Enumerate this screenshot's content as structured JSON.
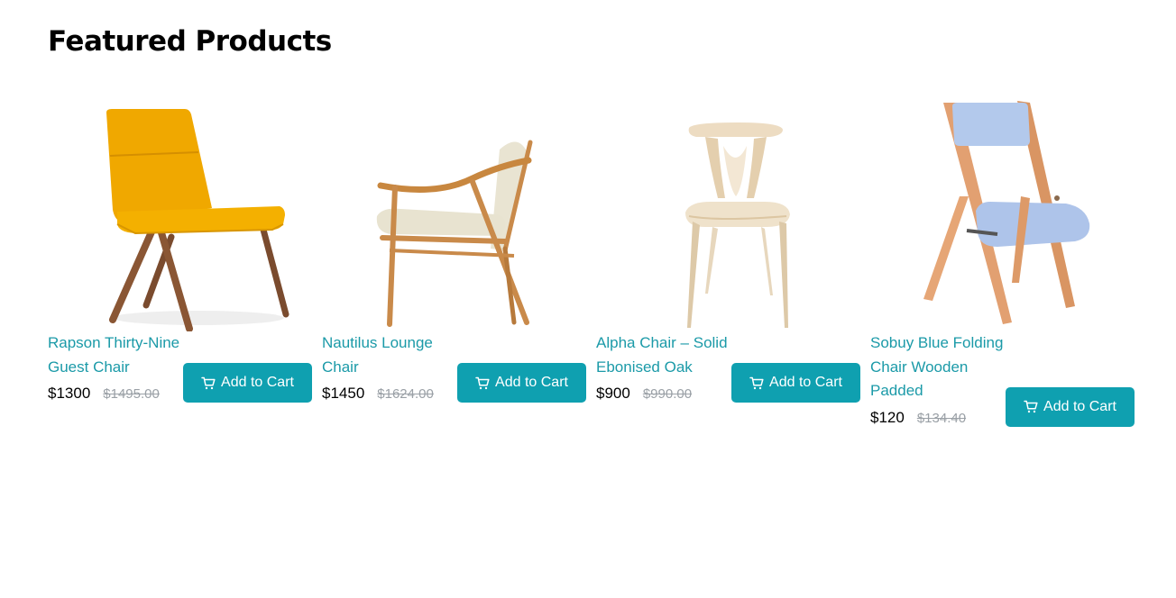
{
  "page": {
    "title": "Featured Products"
  },
  "products": [
    {
      "name": "Rapson Thirty-Nine Guest Chair",
      "price": "$1300",
      "old_price": "$1495.00",
      "button": "Add to Cart",
      "image_icon": "yellow-chair-image"
    },
    {
      "name": "Nautilus Lounge Chair",
      "price": "$1450",
      "old_price": "$1624.00",
      "button": "Add to Cart",
      "image_icon": "lounge-chair-image"
    },
    {
      "name": "Alpha Chair – Solid Ebonised Oak",
      "price": "$900",
      "old_price": "$990.00",
      "button": "Add to Cart",
      "image_icon": "alpha-chair-image"
    },
    {
      "name": "Sobuy Blue Folding Chair Wooden Padded",
      "price": "$120",
      "old_price": "$134.40",
      "button": "Add to Cart",
      "image_icon": "folding-chair-image"
    }
  ],
  "colors": {
    "accent": "#0fa0b0",
    "link": "#1b9aa8",
    "strike": "#9aa0a6"
  }
}
